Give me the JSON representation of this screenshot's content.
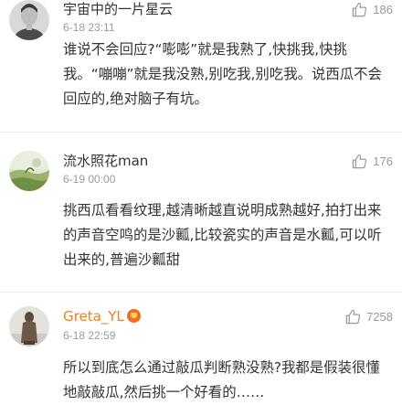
{
  "comments": [
    {
      "username": "宇宙中的一片星云",
      "time": "6-18 23:11",
      "likes": "186",
      "text": "谁说不会回应?“嘭嘭”就是我熟了,快挑我,快挑我。“嘣嘣”就是我没熟,别吃我,别吃我。说西瓜不会回应的,绝对脑子有坑。",
      "avatar_icon": "portrait-avatar"
    },
    {
      "username": "流水照花man",
      "time": "6-19 00:00",
      "likes": "176",
      "text": "挑西瓜看看纹理,越清晰越直说明成熟越好,拍打出来的声音空鸣的是沙瓤,比较瓷实的声音是水瓤,可以听出来的,普遍沙瓤甜",
      "avatar_icon": "landscape-avatar"
    },
    {
      "username": "Greta_YL",
      "time": "6-18 22:59",
      "likes": "7258",
      "text": "所以到底怎么通过敲瓜判断熟没熟?我都是假装很懂地敲敲瓜,然后挑一个好看的……",
      "avatar_icon": "figure-avatar",
      "vip_badge_icon": "vip-member-icon"
    }
  ],
  "colors": {
    "vip_username": "#f2801f",
    "meta_text": "#9a9a9a",
    "body_text": "#333333",
    "divider": "#ececec"
  },
  "icons": {
    "like": "thumbs-up-icon"
  }
}
